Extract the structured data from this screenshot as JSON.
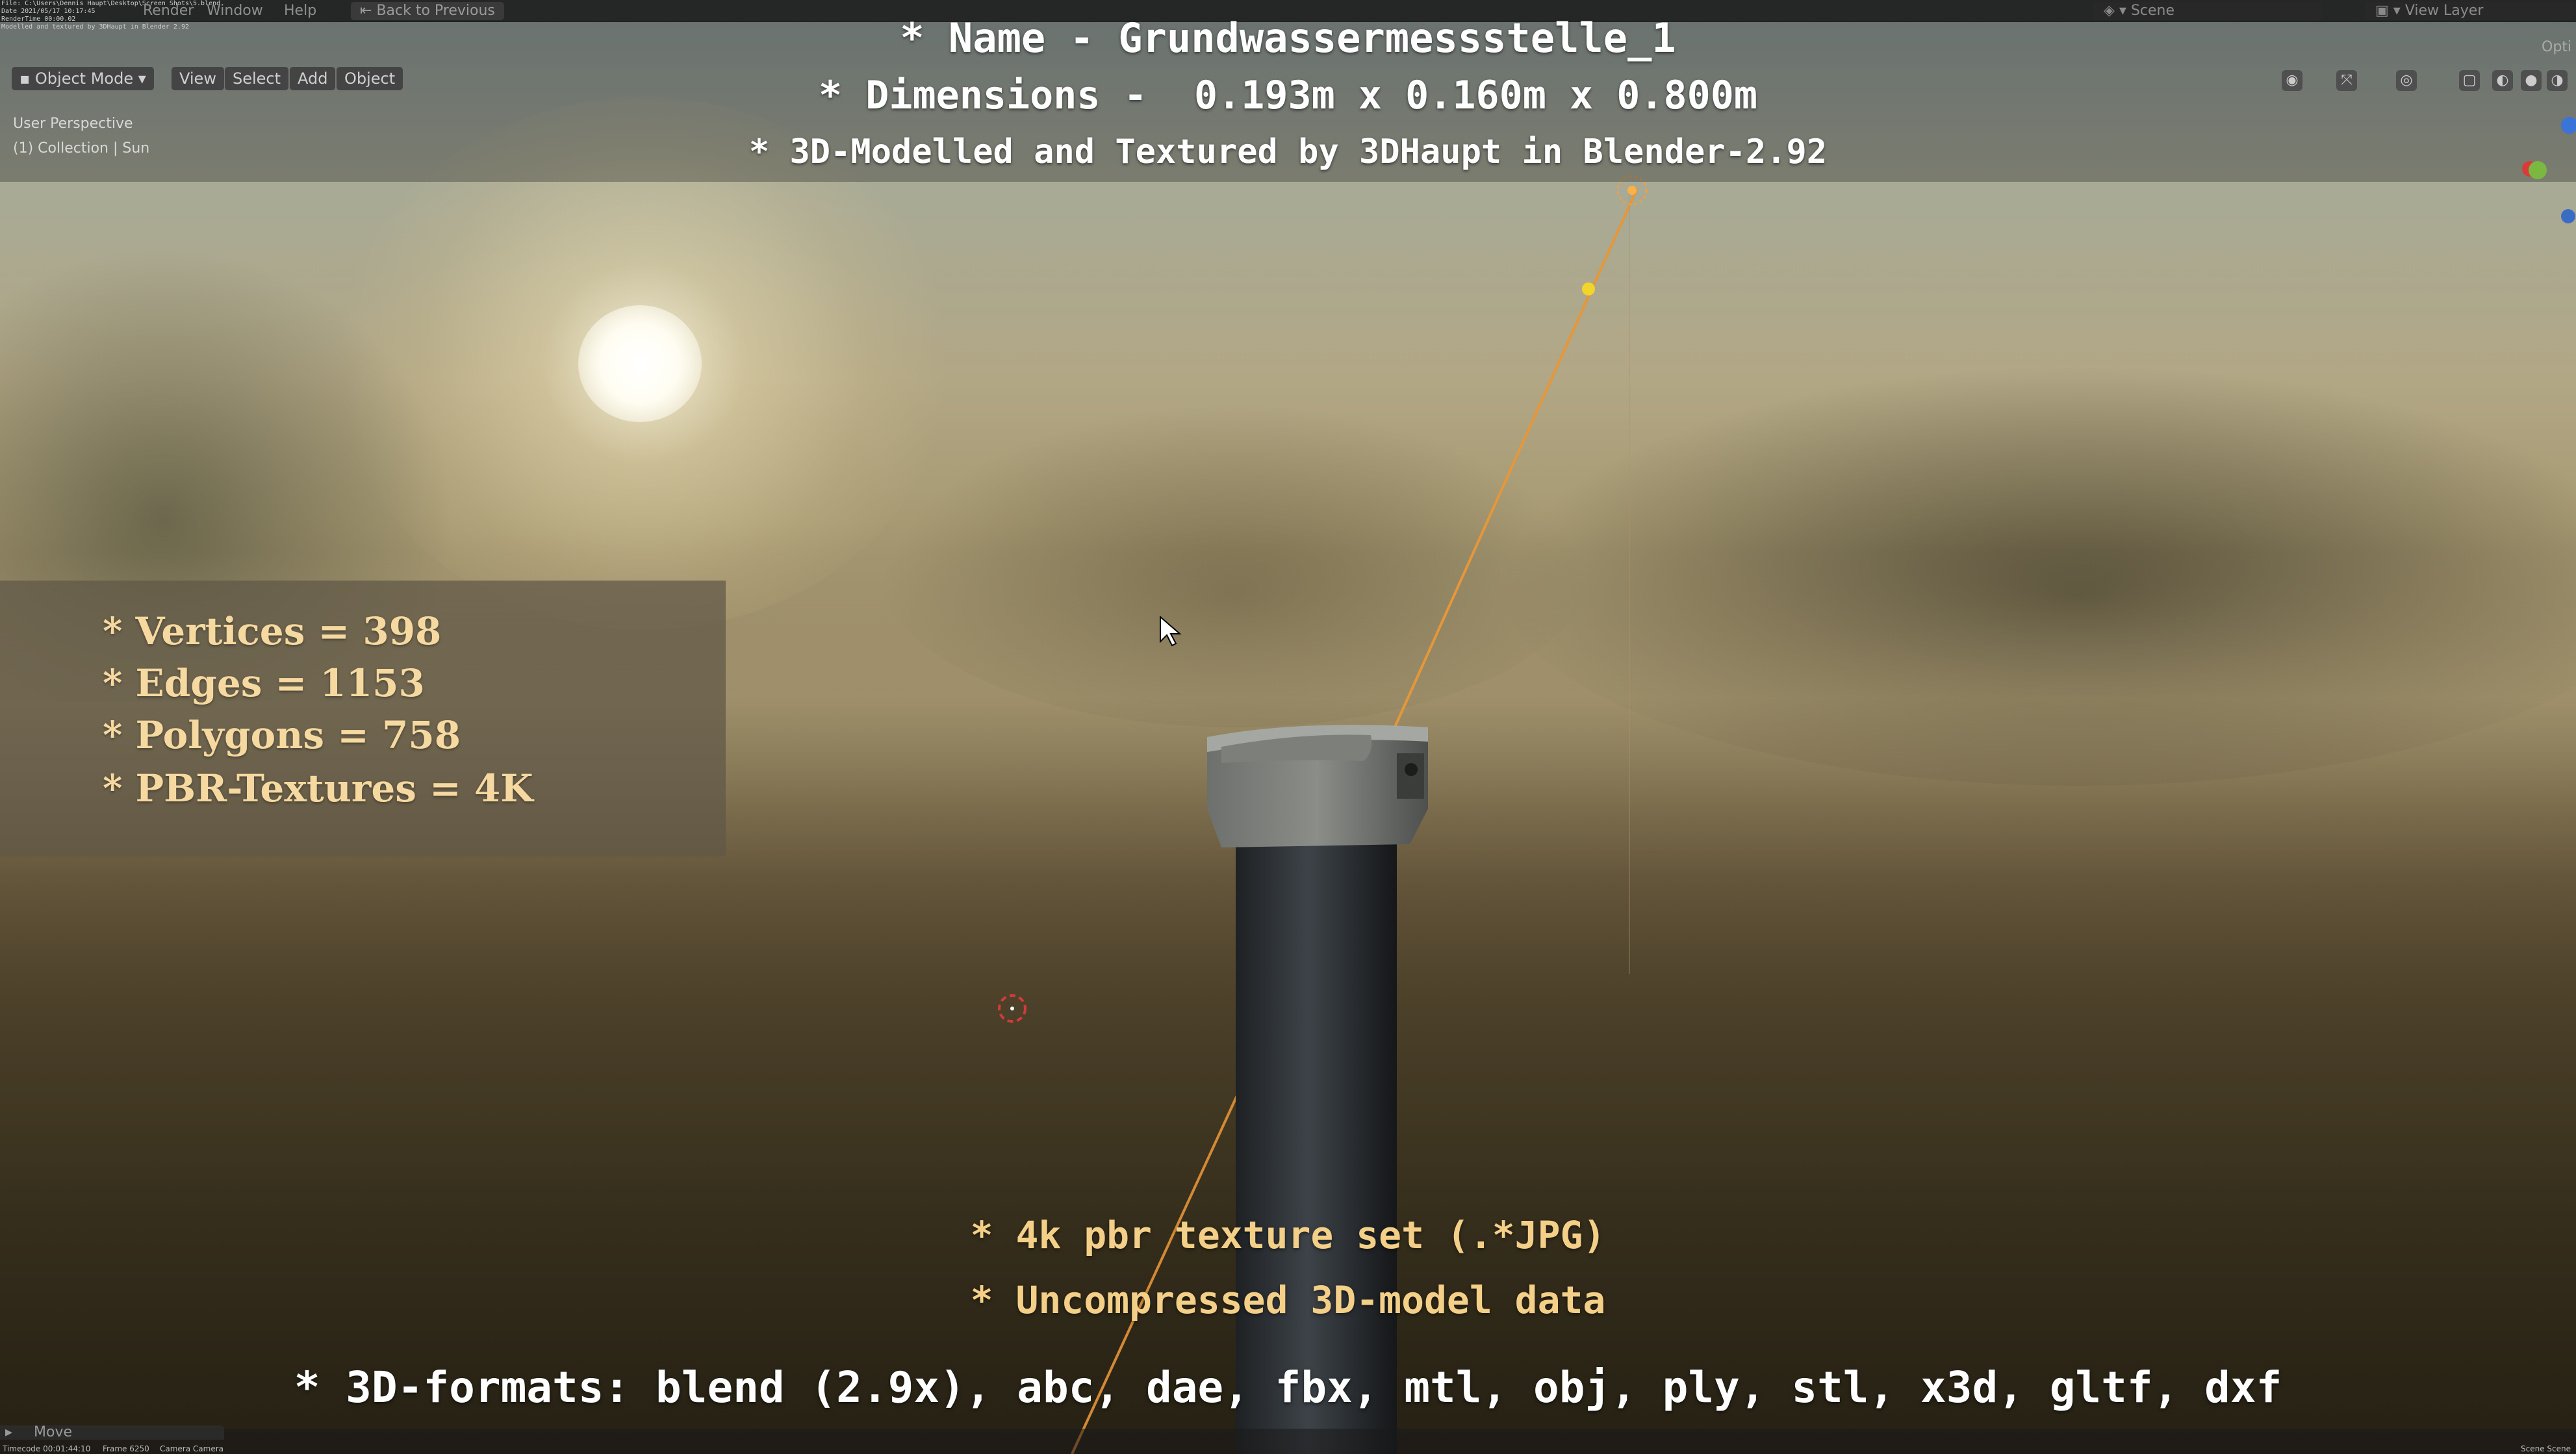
{
  "topbar": {
    "menu_render": "Render",
    "menu_window": "Window",
    "menu_help": "Help",
    "back_button": "Back to Previous",
    "scene_label": "Scene",
    "view_layer_label": "View Layer",
    "options_label": "Opti",
    "render_info": "File: C:\\Users\\Dennis Haupt\\Desktop\\Screen Shots\\5.blend\nDate 2021/05/17 10:17:45\nRenderTime 00:00.02\nModelled and textured by 3DHaupt in Blender 2.92"
  },
  "viewport_header": {
    "mode_label": "Object Mode",
    "menu_view": "View",
    "menu_select": "Select",
    "menu_add": "Add",
    "menu_object": "Object"
  },
  "viewport_info": {
    "perspective": "User Perspective",
    "collection": "(1) Collection | Sun"
  },
  "overlay": {
    "name_line": "* Name - Grundwassermessstelle_1",
    "dimensions_line": "* Dimensions -  0.193m x 0.160m x 0.800m",
    "credits_line": "* 3D-Modelled and Textured by 3DHaupt in Blender-2.92",
    "stats": {
      "vertices": "* Vertices = 398",
      "edges": "* Edges = 1153",
      "polygons": "* Polygons = 758",
      "textures": "* PBR-Textures = 4K"
    },
    "feature_textures": "* 4k pbr texture set (.*JPG)",
    "feature_data": "* Uncompressed 3D-model data",
    "formats": "* 3D-formats: blend (2.9x), abc, dae, fbx, mtl, obj, ply, stl, x3d, gltf, dxf"
  },
  "statusbar": {
    "last_operator": "Move",
    "timecode": "Timecode 00:01:44:10",
    "frame": "Frame 6250",
    "camera": "Camera Camera",
    "right_info": "Scene Scene"
  },
  "colors": {
    "overlay_text": "#ffffff",
    "stats_text": "#f6d9a0",
    "feature_text": "#f3cf88",
    "light_line": "#e89a3c",
    "ui_bar": "#1c1c1c"
  },
  "icons": [
    "cursor-arrow-icon",
    "3d-cursor-icon",
    "sun-light-icon",
    "navigation-gizmo-icon",
    "shading-mode-icon"
  ]
}
